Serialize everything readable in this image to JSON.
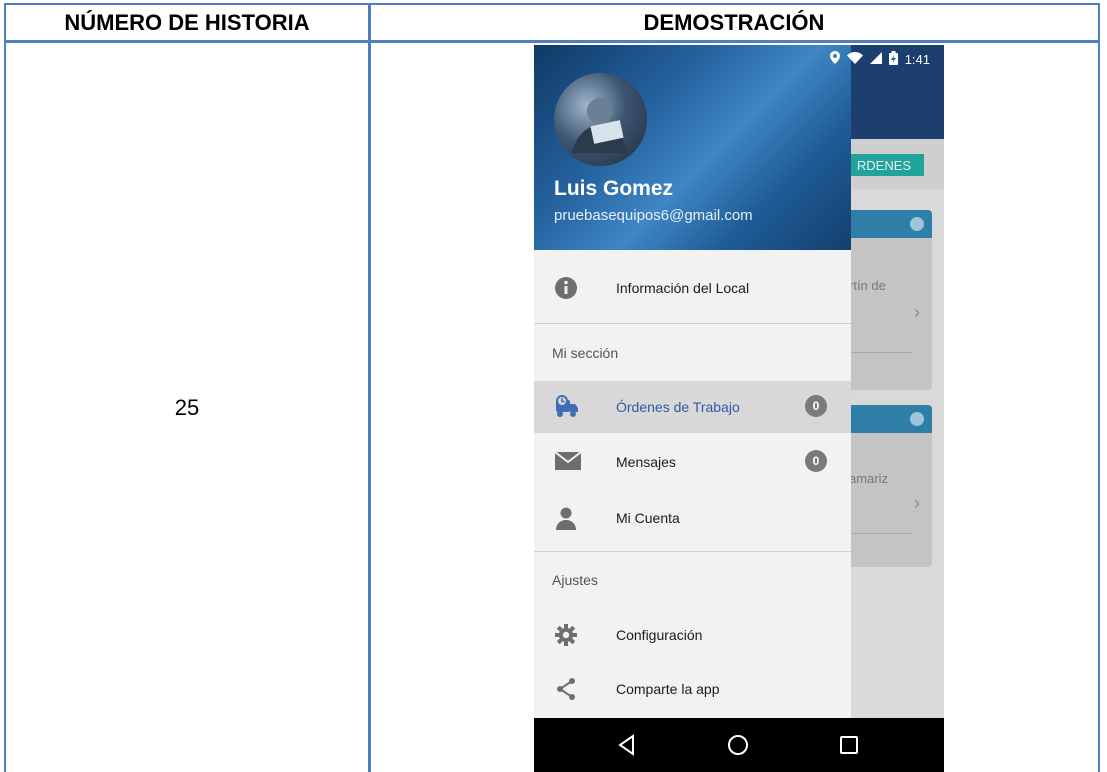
{
  "table": {
    "header_left": "NÚMERO DE HISTORIA",
    "header_right": "DEMOSTRACIÓN",
    "story_number": "25"
  },
  "status_bar": {
    "time": "1:41",
    "icons": [
      "location-icon",
      "wifi-icon",
      "signal-icon",
      "battery-icon"
    ]
  },
  "background_app": {
    "tab_label": "RDENES",
    "card1_text": "rtín de",
    "card2_text": "amariz"
  },
  "drawer": {
    "user_name": "Luis Gomez",
    "user_email": "pruebasequipos6@gmail.com",
    "items": [
      {
        "label": "Información del Local",
        "icon": "info-icon"
      }
    ],
    "section1_title": "Mi sección",
    "section1_items": [
      {
        "label": "Órdenes de Trabajo",
        "icon": "delivery-truck-icon",
        "badge": "0",
        "active": true
      },
      {
        "label": "Mensajes",
        "icon": "mail-icon",
        "badge": "0"
      },
      {
        "label": "Mi Cuenta",
        "icon": "person-icon"
      }
    ],
    "section2_title": "Ajustes",
    "section2_items": [
      {
        "label": "Configuración",
        "icon": "gear-icon"
      },
      {
        "label": "Comparte la app",
        "icon": "share-icon"
      }
    ]
  },
  "nav_bar": {
    "buttons": [
      "back-icon",
      "home-icon",
      "recents-icon"
    ]
  },
  "colors": {
    "table_border": "#4f7fbf",
    "drawer_header": "#2563a0",
    "active_text": "#2f5aa5",
    "tab_accent": "#20a39a"
  }
}
